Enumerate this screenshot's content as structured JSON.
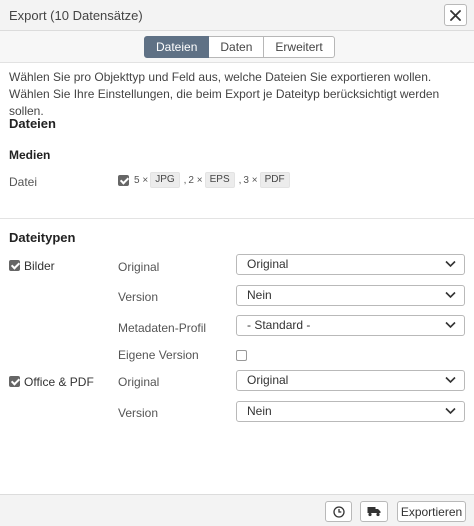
{
  "window": {
    "title": "Export (10 Datensätze)"
  },
  "tabs": [
    {
      "label": "Dateien",
      "active": true
    },
    {
      "label": "Daten",
      "active": false
    },
    {
      "label": "Erweitert",
      "active": false
    }
  ],
  "description": "Wählen Sie pro Objekttyp und Feld aus, welche Dateien Sie exportieren wollen. Wählen Sie Ihre Einstellungen, die beim Export je Dateityp berücksichtigt werden sollen.",
  "files_section": {
    "heading": "Dateien",
    "subheading": "Medien",
    "row_label": "Datei",
    "row_checked": true,
    "items": [
      {
        "count": "5 ×",
        "type": "JPG"
      },
      {
        "count": "2 ×",
        "type": "EPS"
      },
      {
        "count": "3 ×",
        "type": "PDF"
      }
    ],
    "separator": ","
  },
  "filetypes_section": {
    "heading": "Dateitypen",
    "groups": [
      {
        "name": "Bilder",
        "checked": true,
        "fields": [
          {
            "label": "Original",
            "value": "Original"
          },
          {
            "label": "Version",
            "value": "Nein"
          },
          {
            "label": "Metadaten-Profil",
            "value": "- Standard -"
          },
          {
            "label": "Eigene Version",
            "checkbox": false
          }
        ]
      },
      {
        "name": "Office & PDF",
        "checked": true,
        "fields": [
          {
            "label": "Original",
            "value": "Original"
          },
          {
            "label": "Version",
            "value": "Nein"
          }
        ]
      }
    ]
  },
  "footer": {
    "clock_icon": "clock-icon",
    "truck_icon": "truck-icon",
    "export_label": "Exportieren"
  },
  "colors": {
    "active_tab": "#5f7185",
    "checkbox_checked": "#666666"
  }
}
